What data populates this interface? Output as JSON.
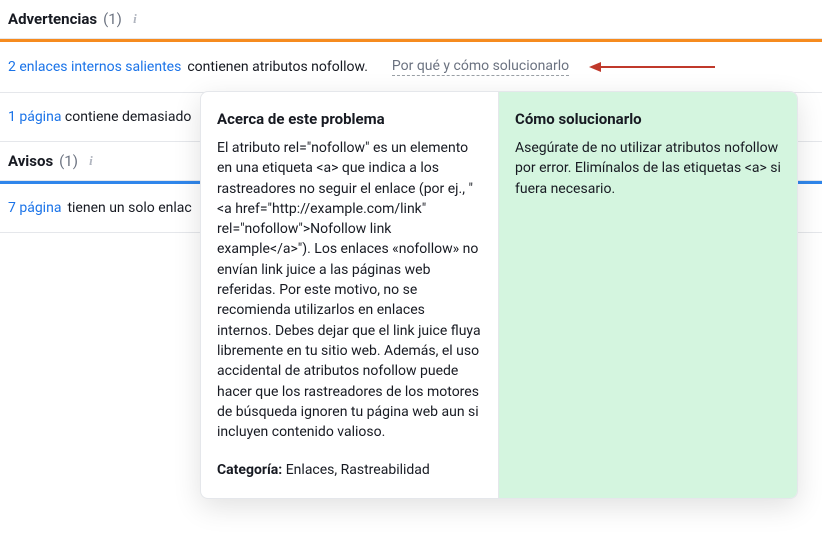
{
  "warnings": {
    "title": "Advertencias",
    "count": "(1)"
  },
  "issue1": {
    "link": "2 enlaces internos salientes",
    "rest": " contienen atributos nofollow.",
    "why": "Por qué y cómo solucionarlo"
  },
  "issue2": {
    "link": "1 página",
    "rest": " contiene demasiado"
  },
  "notices": {
    "title": "Avisos",
    "count": "(1)"
  },
  "issue3": {
    "link": "7 página",
    "rest": " tienen un solo enlac"
  },
  "popover": {
    "about_title": "Acerca de este problema",
    "about_body": "El atributo rel=\"nofollow\" es un elemento en una etiqueta <a> que indica a los rastreadores no seguir el enlace (por ej., \"<a href=\"http://example.com/link\" rel=\"nofollow\">Nofollow link example</a>\"). Los enlaces «nofollow» no envían link juice a las páginas web referidas. Por este motivo, no se recomienda utilizarlos en enlaces internos. Debes dejar que el link juice fluya libremente en tu sitio web. Además, el uso accidental de atributos nofollow puede hacer que los rastreadores de los motores de búsqueda ignoren tu página web aun si incluyen contenido valioso.",
    "category_label": "Categoría:",
    "category_value": " Enlaces, Rastreabilidad",
    "fix_title": "Cómo solucionarlo",
    "fix_body": "Asegúrate de no utilizar atributos nofollow por error. Elimínalos de las etiquetas <a> si fuera necesario."
  }
}
